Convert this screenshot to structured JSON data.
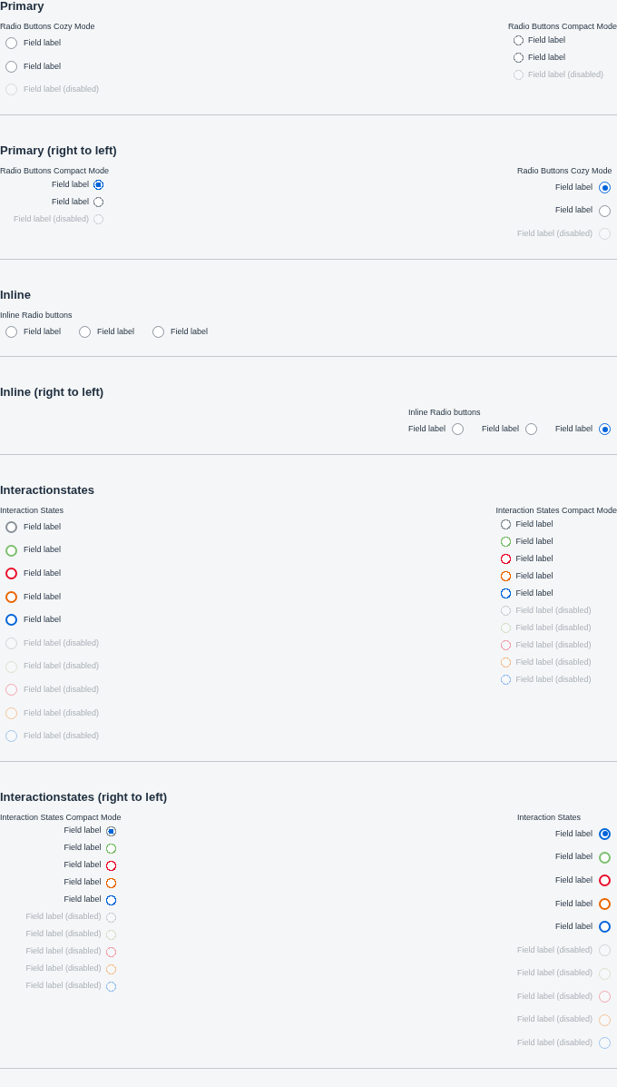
{
  "sections": [
    {
      "title": "Primary",
      "groups": [
        {
          "label": "Radio Buttons Cozy Mode",
          "kind": "stack",
          "compact": false,
          "rtl": false,
          "items": [
            {
              "label": "Field label",
              "selected": false,
              "disabled": false
            },
            {
              "label": "Field label",
              "selected": false,
              "disabled": false
            },
            {
              "label": "Field label (disabled)",
              "selected": false,
              "disabled": true
            }
          ]
        },
        {
          "label": "Radio Buttons Compact Mode",
          "kind": "stack",
          "compact": true,
          "rtl": false,
          "items": [
            {
              "label": "Field label",
              "selected": false,
              "disabled": false
            },
            {
              "label": "Field label",
              "selected": false,
              "disabled": false
            },
            {
              "label": "Field label (disabled)",
              "selected": false,
              "disabled": true
            }
          ]
        }
      ]
    },
    {
      "title": "Primary (right to left)",
      "groups": [
        {
          "label": "Radio Buttons Compact Mode",
          "kind": "stack",
          "compact": true,
          "rtl": true,
          "items": [
            {
              "label": "Field label",
              "selected": true,
              "disabled": false
            },
            {
              "label": "Field label",
              "selected": false,
              "disabled": false
            },
            {
              "label": "Field label (disabled)",
              "selected": false,
              "disabled": true
            }
          ]
        },
        {
          "label": "Radio Buttons Cozy Mode",
          "kind": "stack",
          "compact": false,
          "rtl": true,
          "items": [
            {
              "label": "Field label",
              "selected": true,
              "disabled": false
            },
            {
              "label": "Field label",
              "selected": false,
              "disabled": false
            },
            {
              "label": "Field label (disabled)",
              "selected": false,
              "disabled": true
            }
          ]
        }
      ]
    },
    {
      "title": "Inline",
      "groups": [
        {
          "label": "Inline Radio buttons",
          "kind": "inline",
          "compact": false,
          "rtl": false,
          "items": [
            {
              "label": "Field label",
              "selected": false,
              "disabled": false
            },
            {
              "label": "Field label",
              "selected": false,
              "disabled": false
            },
            {
              "label": "Field label",
              "selected": false,
              "disabled": false
            }
          ]
        }
      ]
    },
    {
      "title": "Inline (right to left)",
      "groups": [
        {
          "label": "Inline Radio buttons",
          "kind": "inline",
          "compact": false,
          "rtl": true,
          "items": [
            {
              "label": "Field label",
              "selected": false,
              "disabled": false
            },
            {
              "label": "Field label",
              "selected": false,
              "disabled": false
            },
            {
              "label": "Field label",
              "selected": true,
              "disabled": false
            }
          ]
        }
      ]
    },
    {
      "title": "Interactionstates",
      "groups": [
        {
          "label": "Interaction States",
          "kind": "stack",
          "compact": false,
          "rtl": false,
          "items": [
            {
              "label": "Field label",
              "selected": false,
              "disabled": false,
              "color": "#89919a"
            },
            {
              "label": "Field label",
              "selected": false,
              "disabled": false,
              "color": "#7cbf6e"
            },
            {
              "label": "Field label",
              "selected": false,
              "disabled": false,
              "color": "#e90b2b"
            },
            {
              "label": "Field label",
              "selected": false,
              "disabled": false,
              "color": "#e76500"
            },
            {
              "label": "Field label",
              "selected": false,
              "disabled": false,
              "color": "#0064d9"
            },
            {
              "label": "Field label (disabled)",
              "selected": false,
              "disabled": true,
              "color": "#cfd3d7"
            },
            {
              "label": "Field label (disabled)",
              "selected": false,
              "disabled": true,
              "color": "#d6e2cd"
            },
            {
              "label": "Field label (disabled)",
              "selected": false,
              "disabled": true,
              "color": "#f2a5b0"
            },
            {
              "label": "Field label (disabled)",
              "selected": false,
              "disabled": true,
              "color": "#f3c399"
            },
            {
              "label": "Field label (disabled)",
              "selected": false,
              "disabled": true,
              "color": "#9cc4f0"
            }
          ]
        },
        {
          "label": "Interaction States Compact Mode",
          "kind": "stack",
          "compact": true,
          "rtl": false,
          "items": [
            {
              "label": "Field label",
              "selected": false,
              "disabled": false,
              "color": "#89919a"
            },
            {
              "label": "Field label",
              "selected": false,
              "disabled": false,
              "color": "#7cbf6e"
            },
            {
              "label": "Field label",
              "selected": false,
              "disabled": false,
              "color": "#e90b2b"
            },
            {
              "label": "Field label",
              "selected": false,
              "disabled": false,
              "color": "#e76500"
            },
            {
              "label": "Field label",
              "selected": false,
              "disabled": false,
              "color": "#0064d9"
            },
            {
              "label": "Field label (disabled)",
              "selected": false,
              "disabled": true,
              "color": "#cfd3d7"
            },
            {
              "label": "Field label (disabled)",
              "selected": false,
              "disabled": true,
              "color": "#d6e2cd"
            },
            {
              "label": "Field label (disabled)",
              "selected": false,
              "disabled": true,
              "color": "#f2a5b0"
            },
            {
              "label": "Field label (disabled)",
              "selected": false,
              "disabled": true,
              "color": "#f3c399"
            },
            {
              "label": "Field label (disabled)",
              "selected": false,
              "disabled": true,
              "color": "#9cc4f0"
            }
          ]
        }
      ]
    },
    {
      "title": "Interactionstates (right to left)",
      "groups": [
        {
          "label": "Interaction States Compact Mode",
          "kind": "stack",
          "compact": true,
          "rtl": true,
          "items": [
            {
              "label": "Field label",
              "selected": true,
              "disabled": false,
              "color": "#89919a"
            },
            {
              "label": "Field label",
              "selected": false,
              "disabled": false,
              "color": "#7cbf6e"
            },
            {
              "label": "Field label",
              "selected": false,
              "disabled": false,
              "color": "#e90b2b"
            },
            {
              "label": "Field label",
              "selected": false,
              "disabled": false,
              "color": "#e76500"
            },
            {
              "label": "Field label",
              "selected": false,
              "disabled": false,
              "color": "#0064d9"
            },
            {
              "label": "Field label (disabled)",
              "selected": false,
              "disabled": true,
              "color": "#cfd3d7"
            },
            {
              "label": "Field label (disabled)",
              "selected": false,
              "disabled": true,
              "color": "#d6e2cd"
            },
            {
              "label": "Field label (disabled)",
              "selected": false,
              "disabled": true,
              "color": "#f2a5b0"
            },
            {
              "label": "Field label (disabled)",
              "selected": false,
              "disabled": true,
              "color": "#f3c399"
            },
            {
              "label": "Field label (disabled)",
              "selected": false,
              "disabled": true,
              "color": "#9cc4f0"
            }
          ]
        },
        {
          "label": "Interaction States",
          "kind": "stack",
          "compact": false,
          "rtl": true,
          "items": [
            {
              "label": "Field label",
              "selected": true,
              "disabled": false,
              "color": "#0064d9"
            },
            {
              "label": "Field label",
              "selected": false,
              "disabled": false,
              "color": "#7cbf6e"
            },
            {
              "label": "Field label",
              "selected": false,
              "disabled": false,
              "color": "#e90b2b"
            },
            {
              "label": "Field label",
              "selected": false,
              "disabled": false,
              "color": "#e76500"
            },
            {
              "label": "Field label",
              "selected": false,
              "disabled": false,
              "color": "#0064d9"
            },
            {
              "label": "Field label (disabled)",
              "selected": false,
              "disabled": true,
              "color": "#cfd3d7"
            },
            {
              "label": "Field label (disabled)",
              "selected": false,
              "disabled": true,
              "color": "#d6e2cd"
            },
            {
              "label": "Field label (disabled)",
              "selected": false,
              "disabled": true,
              "color": "#f2a5b0"
            },
            {
              "label": "Field label (disabled)",
              "selected": false,
              "disabled": true,
              "color": "#f3c399"
            },
            {
              "label": "Field label (disabled)",
              "selected": false,
              "disabled": true,
              "color": "#9cc4f0"
            }
          ]
        }
      ]
    }
  ]
}
